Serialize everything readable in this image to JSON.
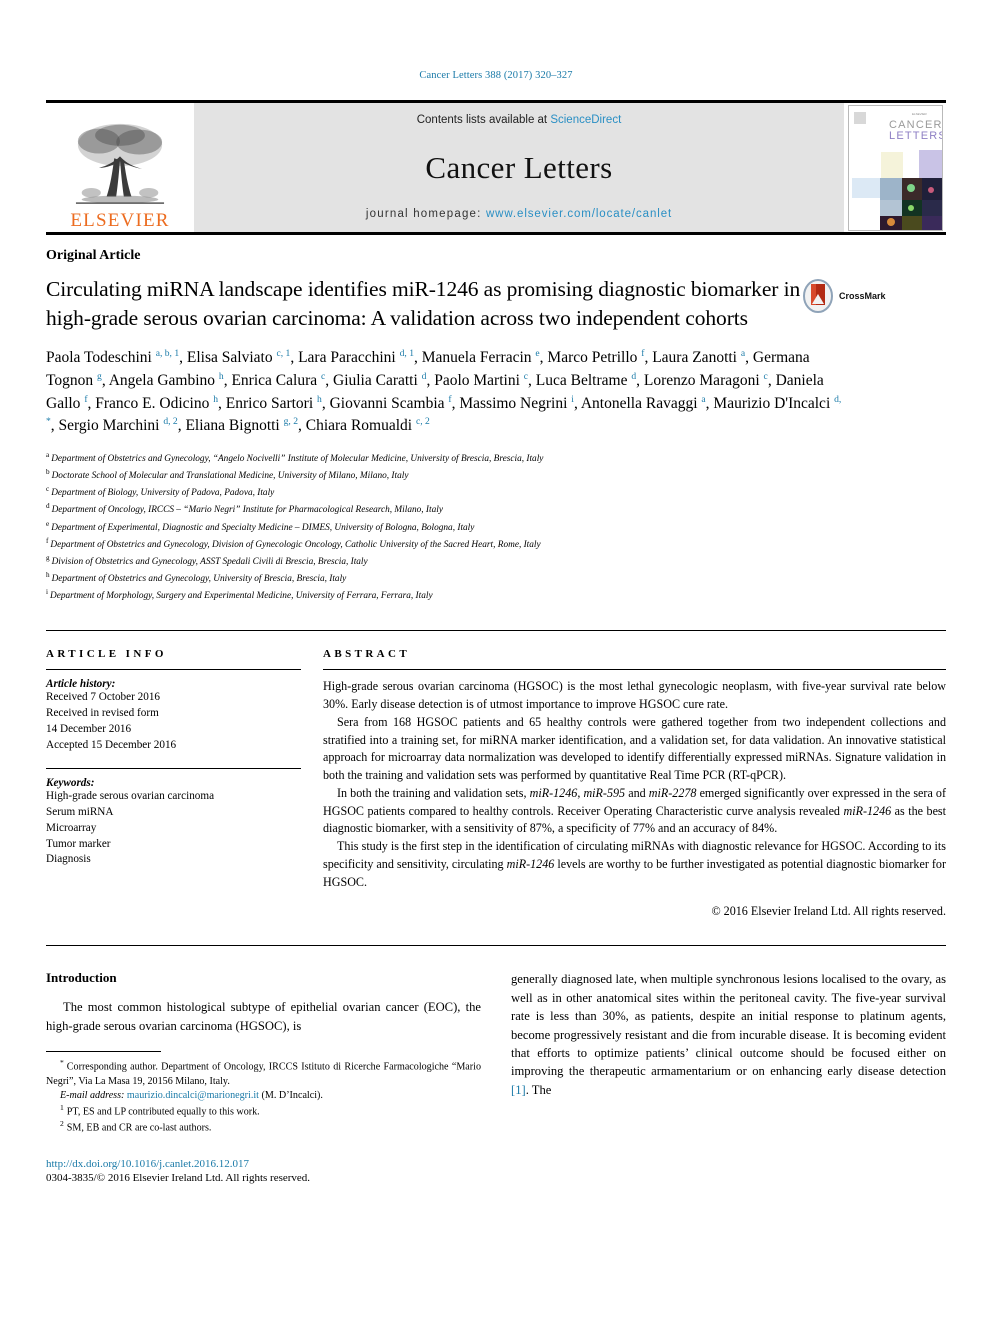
{
  "running_head": "Cancer Letters 388 (2017) 320–327",
  "masthead": {
    "publisher": "ELSEVIER",
    "contents_prefix": "Contents lists available at ",
    "contents_link": "ScienceDirect",
    "journal_name": "Cancer Letters",
    "homepage_prefix": "journal homepage: ",
    "homepage_url": "www.elsevier.com/locate/canlet",
    "cover_title_line1": "CANCER",
    "cover_title_line2": "LETTERS"
  },
  "article_type": "Original Article",
  "title": "Circulating miRNA landscape identifies miR-1246 as promising diagnostic biomarker in high-grade serous ovarian carcinoma: A validation across two independent cohorts",
  "crossmark_label": "CrossMark",
  "authors": [
    {
      "name": "Paola Todeschini",
      "marks": "a, b, 1",
      "sep": ", "
    },
    {
      "name": "Elisa Salviato",
      "marks": "c, 1",
      "sep": ", "
    },
    {
      "name": "Lara Paracchini",
      "marks": "d, 1",
      "sep": ", "
    },
    {
      "name": "Manuela Ferracin",
      "marks": "e",
      "sep": ", "
    },
    {
      "name": "Marco Petrillo",
      "marks": "f",
      "sep": ", "
    },
    {
      "name": "Laura Zanotti",
      "marks": "a",
      "sep": ", "
    },
    {
      "name": "Germana Tognon",
      "marks": "g",
      "sep": ", "
    },
    {
      "name": "Angela Gambino",
      "marks": "h",
      "sep": ", "
    },
    {
      "name": "Enrica Calura",
      "marks": "c",
      "sep": ", "
    },
    {
      "name": "Giulia Caratti",
      "marks": "d",
      "sep": ", "
    },
    {
      "name": "Paolo Martini",
      "marks": "c",
      "sep": ", "
    },
    {
      "name": "Luca Beltrame",
      "marks": "d",
      "sep": ", "
    },
    {
      "name": "Lorenzo Maragoni",
      "marks": "c",
      "sep": ", "
    },
    {
      "name": "Daniela Gallo",
      "marks": "f",
      "sep": ", "
    },
    {
      "name": "Franco E. Odicino",
      "marks": "h",
      "sep": ", "
    },
    {
      "name": "Enrico Sartori",
      "marks": "h",
      "sep": ", "
    },
    {
      "name": "Giovanni Scambia",
      "marks": "f",
      "sep": ", "
    },
    {
      "name": "Massimo Negrini",
      "marks": "i",
      "sep": ", "
    },
    {
      "name": "Antonella Ravaggi",
      "marks": "a",
      "sep": ", "
    },
    {
      "name": "Maurizio D'Incalci",
      "marks": "d, *",
      "sep": ", "
    },
    {
      "name": "Sergio Marchini",
      "marks": "d, 2",
      "sep": ", "
    },
    {
      "name": "Eliana Bignotti",
      "marks": "g, 2",
      "sep": ", "
    },
    {
      "name": "Chiara Romualdi",
      "marks": "c, 2",
      "sep": ""
    }
  ],
  "affiliations": [
    {
      "mark": "a",
      "text": "Department of Obstetrics and Gynecology, “Angelo Nocivelli” Institute of Molecular Medicine, University of Brescia, Brescia, Italy"
    },
    {
      "mark": "b",
      "text": "Doctorate School of Molecular and Translational Medicine, University of Milano, Milano, Italy"
    },
    {
      "mark": "c",
      "text": "Department of Biology, University of Padova, Padova, Italy"
    },
    {
      "mark": "d",
      "text": "Department of Oncology, IRCCS – “Mario Negri” Institute for Pharmacological Research, Milano, Italy"
    },
    {
      "mark": "e",
      "text": "Department of Experimental, Diagnostic and Specialty Medicine – DIMES, University of Bologna, Bologna, Italy"
    },
    {
      "mark": "f",
      "text": "Department of Obstetrics and Gynecology, Division of Gynecologic Oncology, Catholic University of the Sacred Heart, Rome, Italy"
    },
    {
      "mark": "g",
      "text": "Division of Obstetrics and Gynecology, ASST Spedali Civili di Brescia, Brescia, Italy"
    },
    {
      "mark": "h",
      "text": "Department of Obstetrics and Gynecology, University of Brescia, Brescia, Italy"
    },
    {
      "mark": "i",
      "text": "Department of Morphology, Surgery and Experimental Medicine, University of Ferrara, Ferrara, Italy"
    }
  ],
  "article_info": {
    "heading": "ARTICLE INFO",
    "history_label": "Article history:",
    "history_lines": [
      "Received 7 October 2016",
      "Received in revised form",
      "14 December 2016",
      "Accepted 15 December 2016"
    ],
    "keywords_label": "Keywords:",
    "keywords": [
      "High-grade serous ovarian carcinoma",
      "Serum miRNA",
      "Microarray",
      "Tumor marker",
      "Diagnosis"
    ]
  },
  "abstract": {
    "heading": "ABSTRACT",
    "paragraphs": [
      "High-grade serous ovarian carcinoma (HGSOC) is the most lethal gynecologic neoplasm, with five-year survival rate below 30%. Early disease detection is of utmost importance to improve HGSOC cure rate.",
      "Sera from 168 HGSOC patients and 65 healthy controls were gathered together from two independent collections and stratified into a training set, for miRNA marker identification, and a validation set, for data validation. An innovative statistical approach for microarray data normalization was developed to identify differentially expressed miRNAs. Signature validation in both the training and validation sets was performed by quantitative Real Time PCR (RT-qPCR).",
      "In both the training and validation sets, miR-1246, miR-595 and miR-2278 emerged significantly over expressed in the sera of HGSOC patients compared to healthy controls. Receiver Operating Characteristic curve analysis revealed miR-1246 as the best diagnostic biomarker, with a sensitivity of 87%, a specificity of 77% and an accuracy of 84%.",
      "This study is the first step in the identification of circulating miRNAs with diagnostic relevance for HGSOC. According to its specificity and sensitivity, circulating miR-1246 levels are worthy to be further investigated as potential diagnostic biomarker for HGSOC."
    ],
    "copyright": "© 2016 Elsevier Ireland Ltd. All rights reserved."
  },
  "introduction": {
    "heading": "Introduction",
    "left_paragraph": "The most common histological subtype of epithelial ovarian cancer (EOC), the high-grade serous ovarian carcinoma (HGSOC), is",
    "right_paragraph_before_ref": "generally diagnosed late, when multiple synchronous lesions localised to the ovary, as well as in other anatomical sites within the peritoneal cavity. The five-year survival rate is less than 30%, as patients, despite an initial response to platinum agents, become progressively resistant and die from incurable disease. It is becoming evident that efforts to optimize patients’ clinical outcome should be focused either on improving the therapeutic armamentarium or on enhancing early disease detection ",
    "right_reference": "[1]",
    "right_paragraph_after_ref": ". The"
  },
  "footnotes": {
    "corresponding_mark": "*",
    "corresponding_text": "Corresponding author. Department of Oncology, IRCCS Istituto di Ricerche Farmacologiche “Mario Negri”, Via La Masa 19, 20156 Milano, Italy.",
    "email_label": "E-mail address:",
    "email": "maurizio.dincalci@marionegri.it",
    "email_suffix": "(M. D’Incalci).",
    "note1_mark": "1",
    "note1_text": "PT, ES and LP contributed equally to this work.",
    "note2_mark": "2",
    "note2_text": "SM, EB and CR are co-last authors.",
    "doi": "http://dx.doi.org/10.1016/j.canlet.2016.12.017",
    "issn_line": "0304-3835/© 2016 Elsevier Ireland Ltd. All rights reserved."
  },
  "colors": {
    "link_blue": "#1a7aa8",
    "sciencedirect_blue": "#2a8fc4",
    "elsevier_orange": "#ec6c20",
    "banner_gray": "#e3e3e3"
  }
}
